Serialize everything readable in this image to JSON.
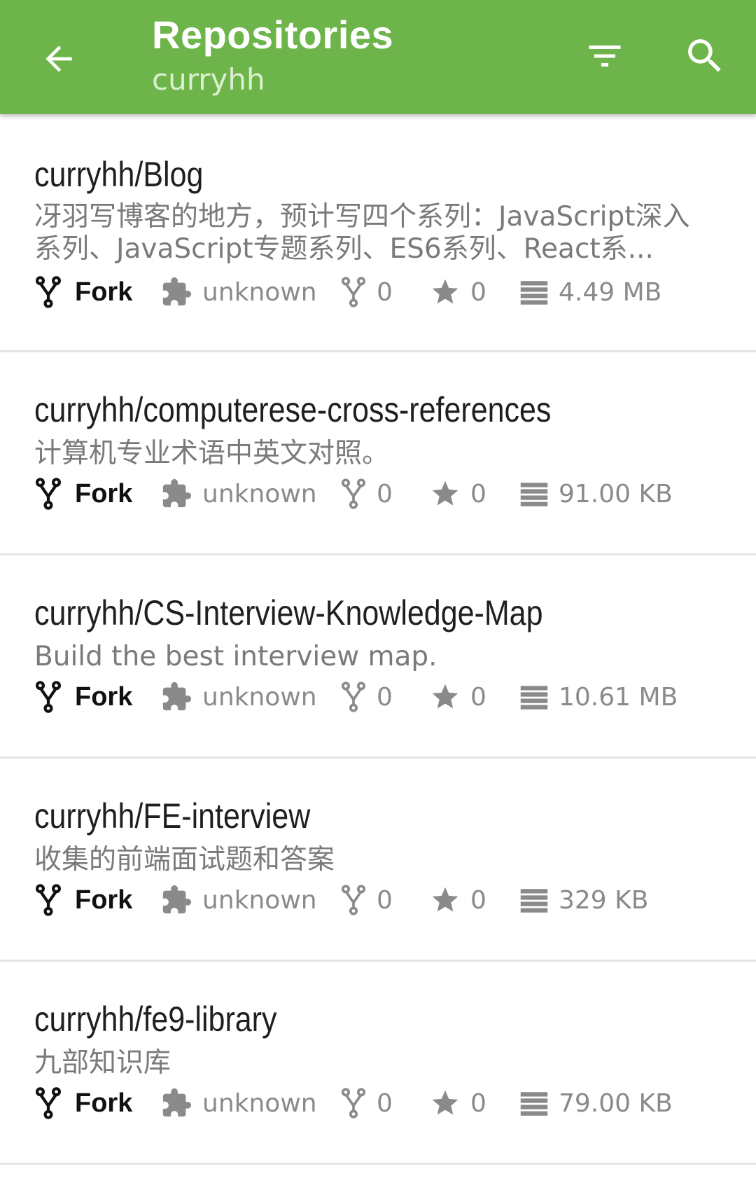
{
  "toolbar": {
    "title": "Repositories",
    "subtitle": "curryhh",
    "back_icon": "arrow-left-icon",
    "filter_icon": "filter-icon",
    "search_icon": "search-icon",
    "background_color": "#6db54a"
  },
  "repositories": [
    {
      "name": "curryhh/Blog",
      "description": "冴羽写博客的地方，预计写四个系列：JavaScript深入系列、JavaScript专题系列、ES6系列、React系...",
      "type": "Fork",
      "language": "unknown",
      "forks": "0",
      "stars": "0",
      "size": "4.49 MB"
    },
    {
      "name": "curryhh/computerese-cross-references",
      "description": "计算机专业术语中英文对照。",
      "type": "Fork",
      "language": "unknown",
      "forks": "0",
      "stars": "0",
      "size": "91.00 KB"
    },
    {
      "name": "curryhh/CS-Interview-Knowledge-Map",
      "description": "Build the best interview map.",
      "type": "Fork",
      "language": "unknown",
      "forks": "0",
      "stars": "0",
      "size": "10.61 MB"
    },
    {
      "name": "curryhh/FE-interview",
      "description": "收集的前端面试题和答案",
      "type": "Fork",
      "language": "unknown",
      "forks": "0",
      "stars": "0",
      "size": "329 KB"
    },
    {
      "name": "curryhh/fe9-library",
      "description": "九部知识库",
      "type": "Fork",
      "language": "unknown",
      "forks": "0",
      "stars": "0",
      "size": "79.00 KB"
    }
  ]
}
